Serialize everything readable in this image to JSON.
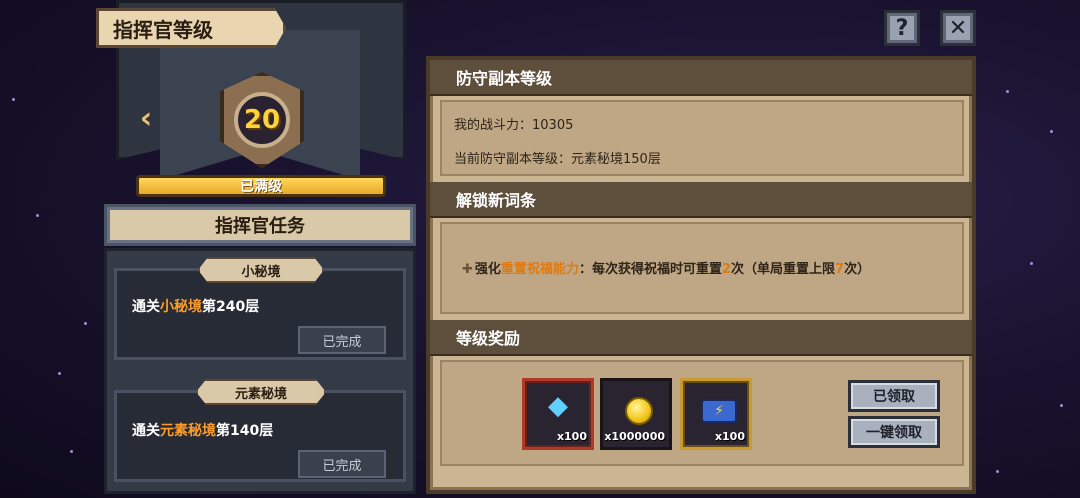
{
  "header": {
    "title": "指挥官等级"
  },
  "top_buttons": {
    "help_glyph": "?",
    "close_glyph": "✕"
  },
  "commander": {
    "level": "20",
    "status": "已满级"
  },
  "tasks": {
    "header": "指挥官任务",
    "items": [
      {
        "tag": "小秘境",
        "prefix": "通关",
        "highlight": "小秘境",
        "suffix": "第240层",
        "status": "已完成"
      },
      {
        "tag": "元素秘境",
        "prefix": "通关",
        "highlight": "元素秘境",
        "suffix": "第140层",
        "status": "已完成"
      }
    ]
  },
  "defense": {
    "title": "防守副本等级",
    "power_label": "我的战斗力：10305",
    "current_label": "当前防守副本等级：元素秘境150层"
  },
  "unlock": {
    "title": "解锁新词条",
    "plus": "✚",
    "text_prefix": "强化",
    "text_highlight": "重置祝福能力",
    "text_middle": "：每次获得祝福时可重置",
    "count_a": "2",
    "text_middle2": "次（单局重置上限",
    "count_b": "7",
    "text_suffix": "次）"
  },
  "rewards": {
    "title": "等级奖励",
    "items": [
      {
        "icon": "diamond-icon",
        "qty": "x100"
      },
      {
        "icon": "gold-coin-icon",
        "qty": "x1000000"
      },
      {
        "icon": "battery-icon",
        "qty": "x100"
      }
    ],
    "claimed_label": "已领取",
    "claim_all_label": "一键领取"
  },
  "colors": {
    "highlight_orange": "#ff9d2a",
    "level_gold": "#ffd23c",
    "panel_tan": "#cbb694",
    "section_brown": "#5e4e3c"
  }
}
